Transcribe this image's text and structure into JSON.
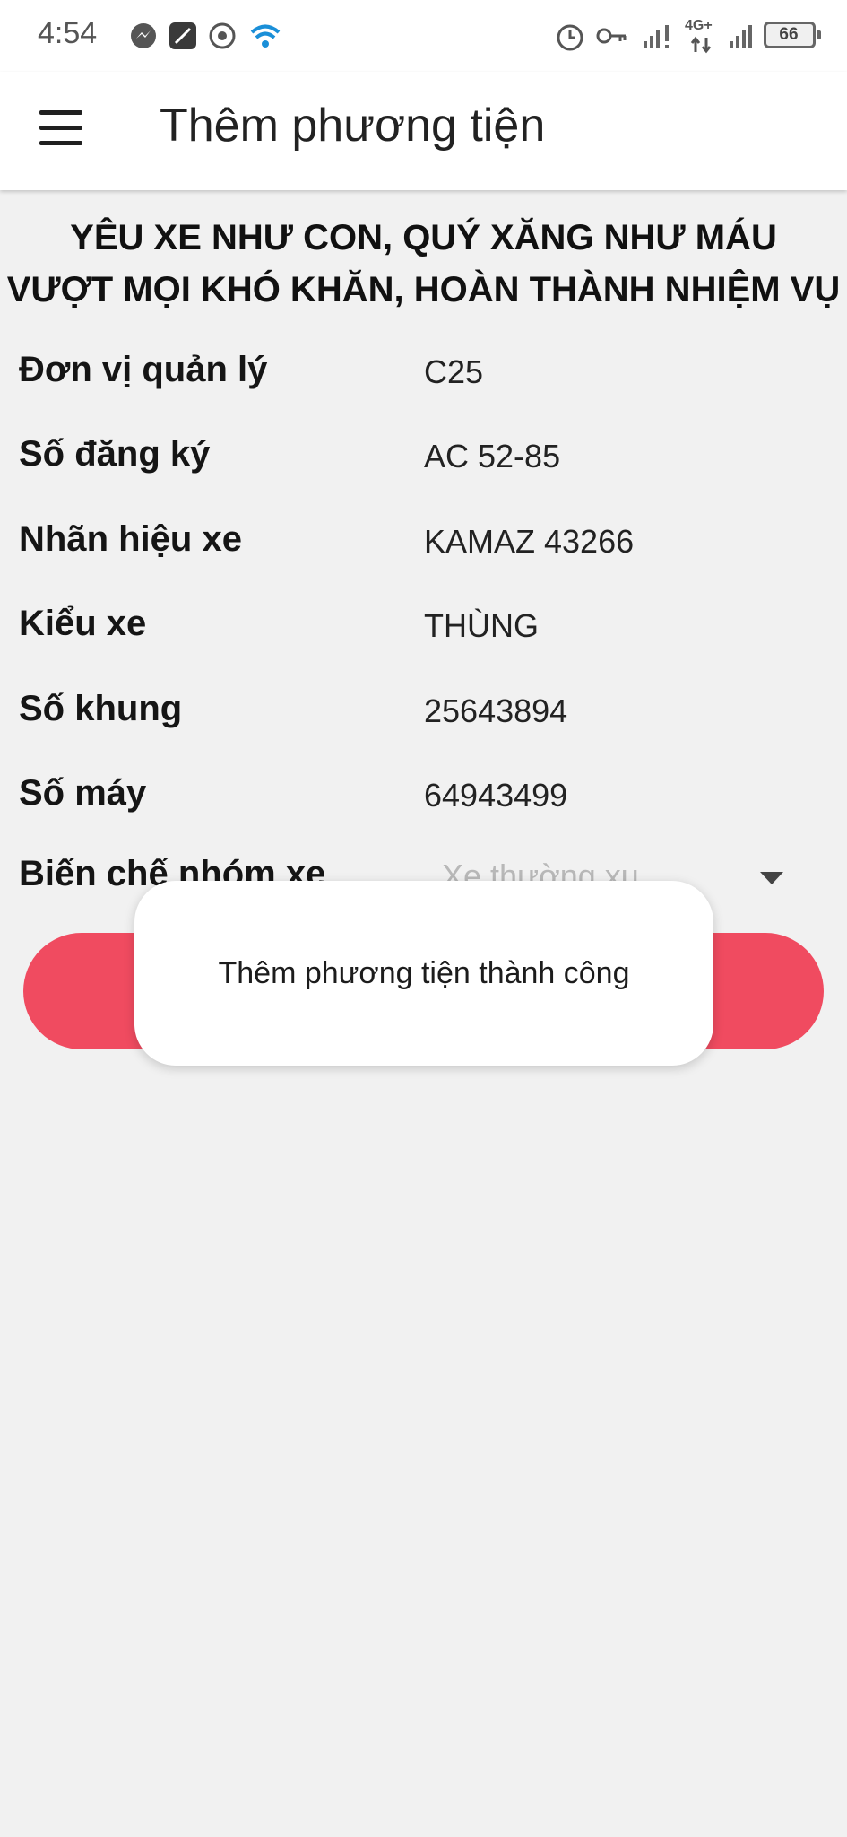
{
  "status_bar": {
    "time": "4:54",
    "battery": "66",
    "network": "4G+",
    "left_icons": [
      "messenger-icon",
      "app-icon",
      "settings-icon",
      "wifi-icon"
    ],
    "right_icons": [
      "alarm-icon",
      "key-icon",
      "signal-icon",
      "4g-signal-icon",
      "signal-icon",
      "battery-icon"
    ]
  },
  "app_bar": {
    "title": "Thêm phương tiện",
    "menu_icon": "menu-icon"
  },
  "slogan": {
    "line1": "YÊU XE NHƯ CON, QUÝ XĂNG NHƯ MÁU",
    "line2": "VƯỢT MỌI KHÓ KHĂN, HOÀN THÀNH NHIỆM VỤ"
  },
  "form": {
    "fields": [
      {
        "label": "Đơn vị quản lý",
        "value": "C25"
      },
      {
        "label": "Số đăng ký",
        "value": "AC 52-85"
      },
      {
        "label": "Nhãn hiệu xe",
        "value": "KAMAZ 43266"
      },
      {
        "label": "Kiểu xe",
        "value": "THÙNG"
      },
      {
        "label": "Số khung",
        "value": "25643894"
      },
      {
        "label": "Số máy",
        "value": "64943499"
      }
    ],
    "dropdown": {
      "label": "Biến chế nhóm xe",
      "value": "Xe thường xu"
    }
  },
  "toast": {
    "message": "Thêm phương tiện thành công"
  },
  "colors": {
    "accent": "#f04b60",
    "background": "#f1f1f1",
    "surface": "#ffffff"
  }
}
